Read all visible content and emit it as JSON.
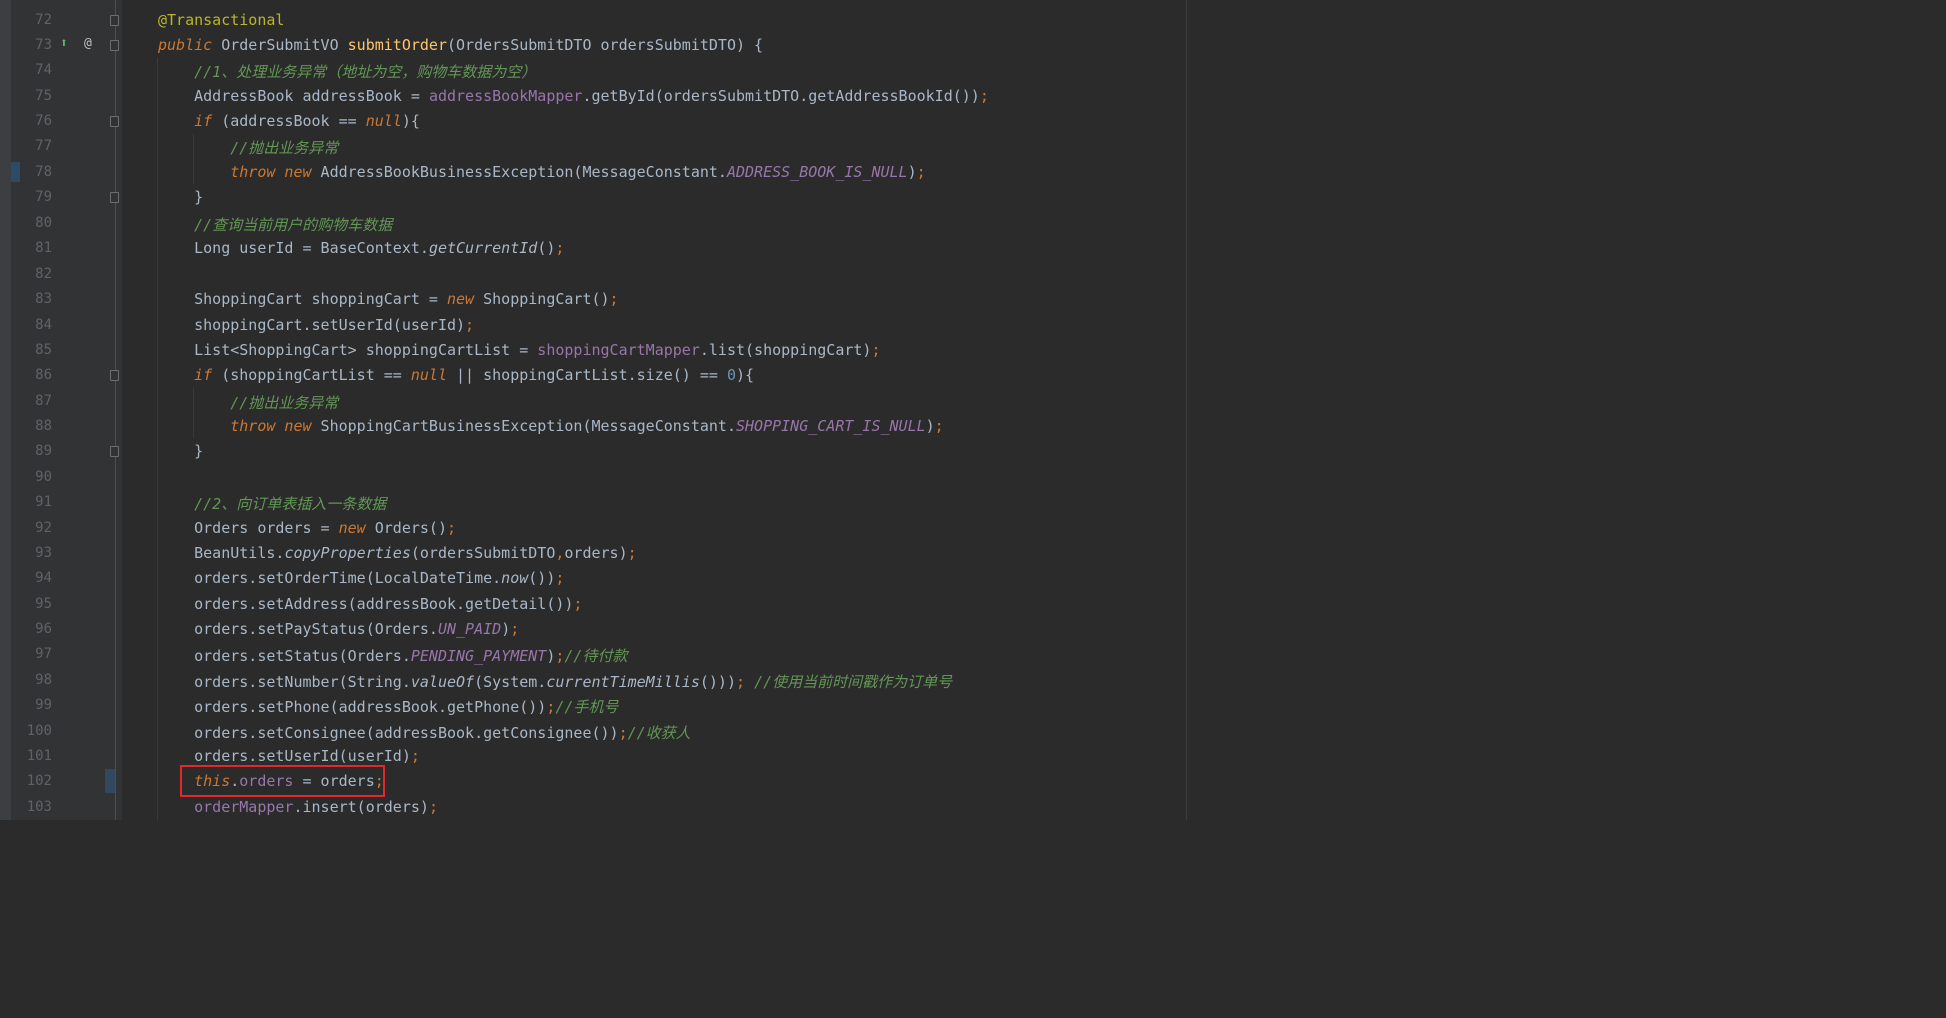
{
  "editor": {
    "gutter_icons": [
      "override-icon",
      "at-icon"
    ],
    "highlighted_line": 102,
    "lines": [
      {
        "num": "72",
        "text": "@Transactional"
      },
      {
        "num": "73",
        "text": "public OrderSubmitVO submitOrder(OrdersSubmitDTO ordersSubmitDTO) {"
      },
      {
        "num": "74",
        "text": "    //1、处理业务异常（地址为空，购物车数据为空）"
      },
      {
        "num": "75",
        "text": "    AddressBook addressBook = addressBookMapper.getById(ordersSubmitDTO.getAddressBookId());"
      },
      {
        "num": "76",
        "text": "    if (addressBook == null){"
      },
      {
        "num": "77",
        "text": "        //抛出业务异常"
      },
      {
        "num": "78",
        "text": "        throw new AddressBookBusinessException(MessageConstant.ADDRESS_BOOK_IS_NULL);"
      },
      {
        "num": "79",
        "text": "    }"
      },
      {
        "num": "80",
        "text": "    //查询当前用户的购物车数据"
      },
      {
        "num": "81",
        "text": "    Long userId = BaseContext.getCurrentId();"
      },
      {
        "num": "82",
        "text": ""
      },
      {
        "num": "83",
        "text": "    ShoppingCart shoppingCart = new ShoppingCart();"
      },
      {
        "num": "84",
        "text": "    shoppingCart.setUserId(userId);"
      },
      {
        "num": "85",
        "text": "    List<ShoppingCart> shoppingCartList = shoppingCartMapper.list(shoppingCart);"
      },
      {
        "num": "86",
        "text": "    if (shoppingCartList == null || shoppingCartList.size() == 0){"
      },
      {
        "num": "87",
        "text": "        //抛出业务异常"
      },
      {
        "num": "88",
        "text": "        throw new ShoppingCartBusinessException(MessageConstant.SHOPPING_CART_IS_NULL);"
      },
      {
        "num": "89",
        "text": "    }"
      },
      {
        "num": "90",
        "text": ""
      },
      {
        "num": "91",
        "text": "    //2、向订单表插入一条数据"
      },
      {
        "num": "92",
        "text": "    Orders orders = new Orders();"
      },
      {
        "num": "93",
        "text": "    BeanUtils.copyProperties(ordersSubmitDTO,orders);"
      },
      {
        "num": "94",
        "text": "    orders.setOrderTime(LocalDateTime.now());"
      },
      {
        "num": "95",
        "text": "    orders.setAddress(addressBook.getDetail());"
      },
      {
        "num": "96",
        "text": "    orders.setPayStatus(Orders.UN_PAID);"
      },
      {
        "num": "97",
        "text": "    orders.setStatus(Orders.PENDING_PAYMENT);//待付款"
      },
      {
        "num": "98",
        "text": "    orders.setNumber(String.valueOf(System.currentTimeMillis())); //使用当前时间戳作为订单号"
      },
      {
        "num": "99",
        "text": "    orders.setPhone(addressBook.getPhone());//手机号"
      },
      {
        "num": "100",
        "text": "    orders.setConsignee(addressBook.getConsignee());//收获人"
      },
      {
        "num": "101",
        "text": "    orders.setUserId(userId);"
      },
      {
        "num": "102",
        "text": "    this.orders = orders;"
      },
      {
        "num": "103",
        "text": "    orderMapper.insert(orders);"
      }
    ]
  }
}
